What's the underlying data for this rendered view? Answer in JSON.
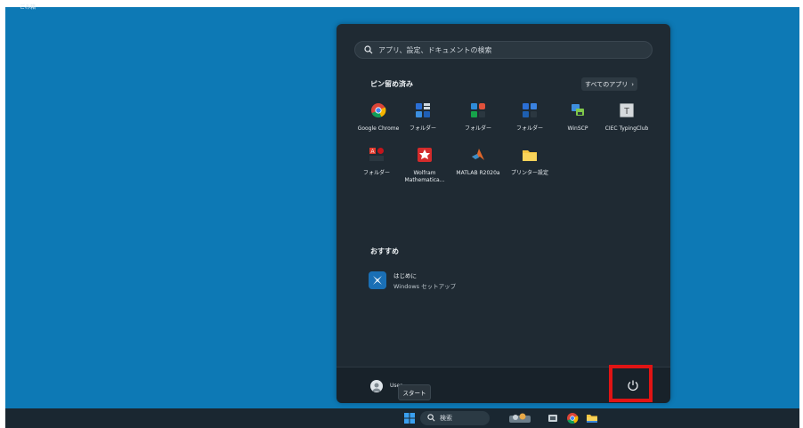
{
  "desktop": {
    "corner_label": "ごみ箱"
  },
  "start_menu": {
    "search_placeholder": "アプリ、設定、ドキュメントの検索",
    "pinned_title": "ピン留め済み",
    "all_apps_label": "すべてのアプリ",
    "all_apps_chevron": "›",
    "pinned_apps": [
      {
        "name": "chrome-icon",
        "label": "Google Chrome"
      },
      {
        "name": "folder-apps-icon",
        "label": "フォルダー"
      },
      {
        "name": "folder-apps-icon",
        "label": "フォルダー"
      },
      {
        "name": "folder-apps-icon",
        "label": "フォルダー"
      },
      {
        "name": "winscp-icon",
        "label": "WinSCP"
      },
      {
        "name": "ciec-icon",
        "label": "CIEC TypingClub"
      },
      {
        "name": "folder-apps-icon",
        "label": "フォルダー"
      },
      {
        "name": "wolfram-icon",
        "label": "Wolfram Mathematica..."
      },
      {
        "name": "matlab-icon",
        "label": "MATLAB R2020a"
      },
      {
        "name": "printer-folder-icon",
        "label": "プリンター設定"
      }
    ],
    "recommended_title": "おすすめ",
    "recommended": [
      {
        "title": "はじめに",
        "subtitle": "Windows セットアップ"
      }
    ],
    "user_name": "User",
    "tooltip": "スタート"
  },
  "taskbar": {
    "search_placeholder": "検索"
  },
  "colors": {
    "desktop": "#0d79b5",
    "menu_bg": "#1f2a33",
    "highlight": "#e01414",
    "taskbar": "#1a2731"
  }
}
